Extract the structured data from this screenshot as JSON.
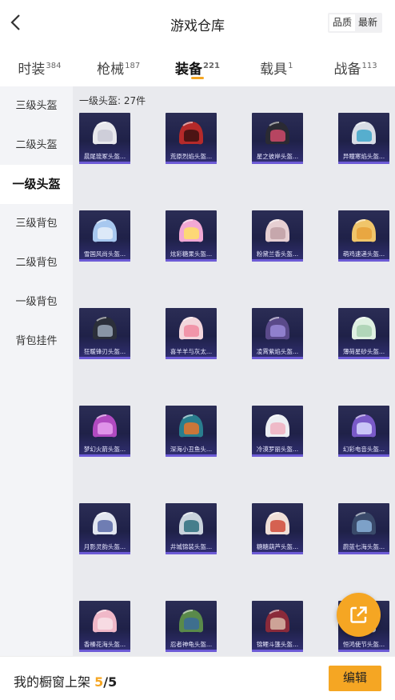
{
  "header": {
    "title": "游戏仓库",
    "sort_options": [
      "品质",
      "最新"
    ],
    "sort_active": 0
  },
  "tabs": [
    {
      "label": "时装",
      "count": "384"
    },
    {
      "label": "枪械",
      "count": "187"
    },
    {
      "label": "装备",
      "count": "221"
    },
    {
      "label": "载具",
      "count": "1"
    },
    {
      "label": "战备",
      "count": "113"
    }
  ],
  "active_tab": 2,
  "sidebar": {
    "items": [
      "三级头盔",
      "二级头盔",
      "一级头盔",
      "三级背包",
      "二级背包",
      "一级背包",
      "背包挂件"
    ],
    "active": 2
  },
  "section": {
    "title": "一级头盔: 27件"
  },
  "items": [
    {
      "name": "晨尾琉冢头盔...",
      "color": "#e8e8ec",
      "accent": "#c9c9d6"
    },
    {
      "name": "荒原烈焰头盔...",
      "color": "#b52a2a",
      "accent": "#3a1010"
    },
    {
      "name": "星之彼岸头盔...",
      "color": "#2a2a33",
      "accent": "#d04a6a"
    },
    {
      "name": "异瞳寒焰头盔...",
      "color": "#d8dde6",
      "accent": "#3fa6c9"
    },
    {
      "name": "雪国风尚头盔...",
      "color": "#a8c8ef",
      "accent": "#e6eef9"
    },
    {
      "name": "炫彩糖果头盔...",
      "color": "#f2a8d4",
      "accent": "#ffe065"
    },
    {
      "name": "粉黛兰香头盔...",
      "color": "#e6cfd2",
      "accent": "#bfa0a6"
    },
    {
      "name": "萌鸡速递头盔...",
      "color": "#f0c56a",
      "accent": "#e8a13a"
    },
    {
      "name": "狂暖锋刃头盔...",
      "color": "#2b2f3a",
      "accent": "#9aa7b8"
    },
    {
      "name": "喜羊羊与灰太...",
      "color": "#f3d6dc",
      "accent": "#f08aa0"
    },
    {
      "name": "凌霄紫焰头盔...",
      "color": "#5a4a8a",
      "accent": "#9a8ad8"
    },
    {
      "name": "薄荷星砂头盔...",
      "color": "#dff0e2",
      "accent": "#a9d1b1"
    },
    {
      "name": "梦幻火箭头盔...",
      "color": "#b04ac0",
      "accent": "#e8a0f0"
    },
    {
      "name": "深海小丑鱼头...",
      "color": "#2a7e8e",
      "accent": "#e8742a"
    },
    {
      "name": "冷漠罗丽头盔...",
      "color": "#eceff3",
      "accent": "#f0b0c0"
    },
    {
      "name": "幻彩电音头盔...",
      "color": "#7a5ac8",
      "accent": "#d8d8ff"
    },
    {
      "name": "月影灵韵头盔...",
      "color": "#e2e6f0",
      "accent": "#5a6aa8"
    },
    {
      "name": "井城锦装头盔...",
      "color": "#c9d3dc",
      "accent": "#2e6e7e"
    },
    {
      "name": "糖糖葫芦头盔...",
      "color": "#f0e0d8",
      "accent": "#d04a3a"
    },
    {
      "name": "蔚蓝七海头盔...",
      "color": "#3a4a6a",
      "accent": "#8ab0d8"
    },
    {
      "name": "香榛花海头盔...",
      "color": "#f0b8c8",
      "accent": "#f8e0e8"
    },
    {
      "name": "忍者神龟头盔...",
      "color": "#5a8a4a",
      "accent": "#3a6a9a"
    },
    {
      "name": "锦鲤斗篷头盔...",
      "color": "#8a2a3a",
      "accent": "#d8b8a8"
    },
    {
      "name": "恒鸿使节头盔...",
      "color": "#c8ccd4",
      "accent": "#7a8aa8"
    }
  ],
  "bottom": {
    "label": "我的橱窗上架",
    "count": "5",
    "total": "/5",
    "edit_label": "编辑"
  },
  "theme": {
    "accent": "#f5a623"
  }
}
